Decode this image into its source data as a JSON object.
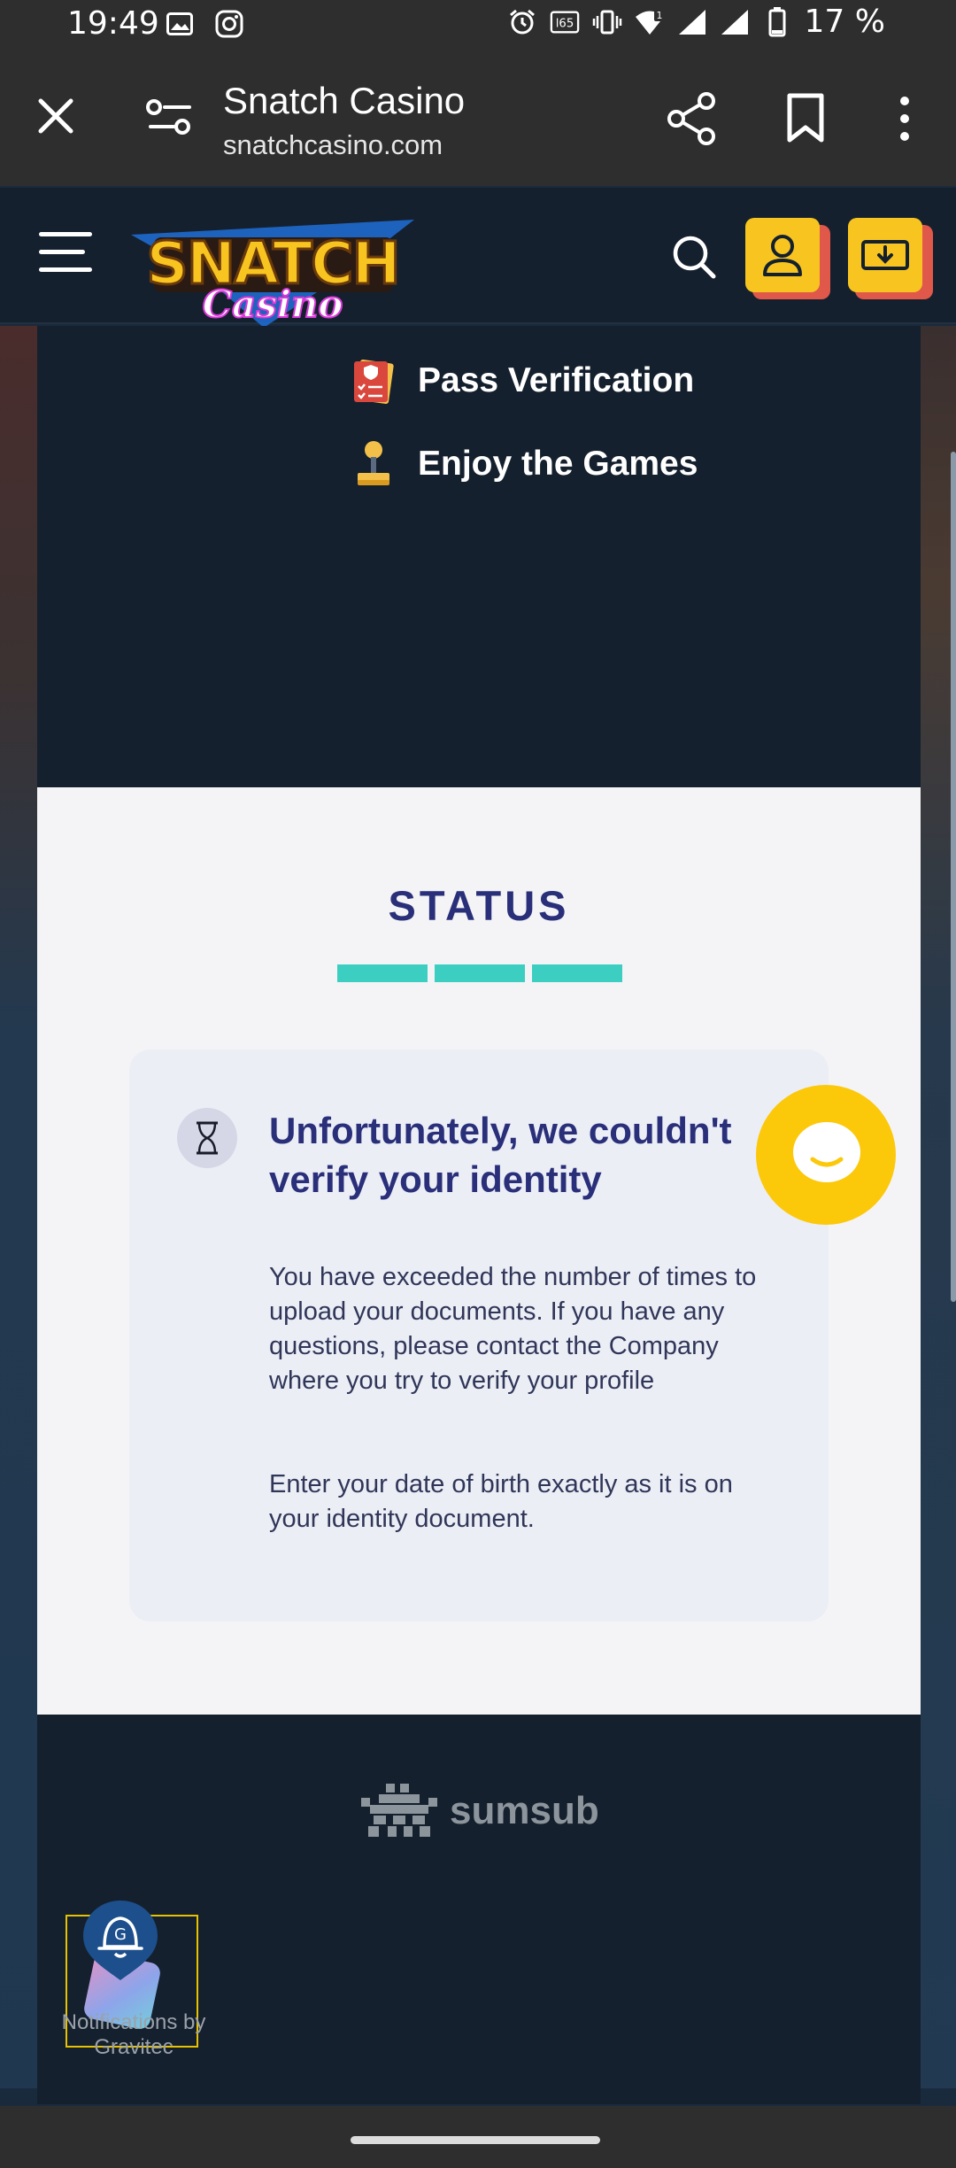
{
  "status_bar": {
    "time": "19:49",
    "battery": "17 %",
    "icons": [
      "image-icon",
      "instagram-icon",
      "alarm-icon",
      "hd-icon",
      "vibrate-icon",
      "wifi-icon",
      "signal-icon",
      "signal-icon",
      "battery-icon"
    ]
  },
  "browser": {
    "title": "Snatch Casino",
    "url": "snatchcasino.com"
  },
  "steps": [
    {
      "label": "Pass Verification",
      "icon": "checklist-icon"
    },
    {
      "label": "Enjoy the Games",
      "icon": "joystick-icon"
    }
  ],
  "status": {
    "title": "STATUS",
    "progress_segments": 3,
    "card_title": "Unfortunately, we couldn't verify your identity",
    "card_body": "You have exceeded the number of times to upload your documents. If you have any questions, please contact the Company where you try to verify your profile",
    "card_note": "Enter your date of birth exactly as it is on your identity document."
  },
  "footer": {
    "brand": "sumsub"
  },
  "notification_widget": {
    "text": "Notifications by Gravitec"
  },
  "colors": {
    "accent_yellow": "#f8c520",
    "status_teal": "#3ccfc1",
    "title_navy": "#2a2f7a",
    "dark_panel": "#15202e"
  }
}
